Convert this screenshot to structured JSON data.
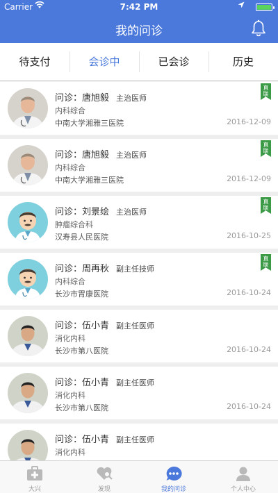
{
  "status": {
    "carrier": "Carrier",
    "time": "7:42 PM"
  },
  "nav": {
    "title": "我的问诊"
  },
  "tabs": [
    {
      "label": "待支付",
      "active": false
    },
    {
      "label": "会诊中",
      "active": true
    },
    {
      "label": "已会诊",
      "active": false
    },
    {
      "label": "历史",
      "active": false
    }
  ],
  "consults": [
    {
      "doctor": "问诊：唐旭毅",
      "rank": "主治医师",
      "dept": "内科综合",
      "hospital": "中南大学湘雅三医院",
      "date": "2016-12-09",
      "ribbon": "直联",
      "avatar": "photo-doctor"
    },
    {
      "doctor": "问诊：唐旭毅",
      "rank": "主治医师",
      "dept": "内科综合",
      "hospital": "中南大学湘雅三医院",
      "date": "2016-12-09",
      "ribbon": "直联",
      "avatar": "photo-doctor"
    },
    {
      "doctor": "问诊：刘景绘",
      "rank": "主治医师",
      "dept": "肿瘤综合科",
      "hospital": "汉寿县人民医院",
      "date": "2016-10-25",
      "ribbon": "直联",
      "avatar": "cartoon-doctor"
    },
    {
      "doctor": "问诊：周再秋",
      "rank": "副主任技师",
      "dept": "内科综合",
      "hospital": "长沙市胃康医院",
      "date": "2016-10-24",
      "ribbon": "直联",
      "avatar": "cartoon-doctor"
    },
    {
      "doctor": "问诊：伍小青",
      "rank": "副主任医师",
      "dept": "消化内科",
      "hospital": "长沙市第八医院",
      "date": "2016-10-24",
      "ribbon": "",
      "avatar": "photo-doctor-2"
    },
    {
      "doctor": "问诊：伍小青",
      "rank": "副主任医师",
      "dept": "消化内科",
      "hospital": "长沙市第八医院",
      "date": "2016-10-24",
      "ribbon": "",
      "avatar": "photo-doctor-2"
    },
    {
      "doctor": "问诊：伍小青",
      "rank": "副主任医师",
      "dept": "消化内科",
      "hospital": "",
      "date": "",
      "ribbon": "",
      "avatar": "photo-doctor-2"
    }
  ],
  "tabbar": [
    {
      "label": "大兴",
      "icon": "medkit-icon",
      "active": false
    },
    {
      "label": "发现",
      "icon": "heart-search-icon",
      "active": false
    },
    {
      "label": "我的问诊",
      "icon": "chat-icon",
      "active": true
    },
    {
      "label": "个人中心",
      "icon": "person-icon",
      "active": false
    }
  ],
  "colors": {
    "primary": "#4a78db",
    "ribbon": "#3a9a46",
    "background": "#eeeeee"
  }
}
